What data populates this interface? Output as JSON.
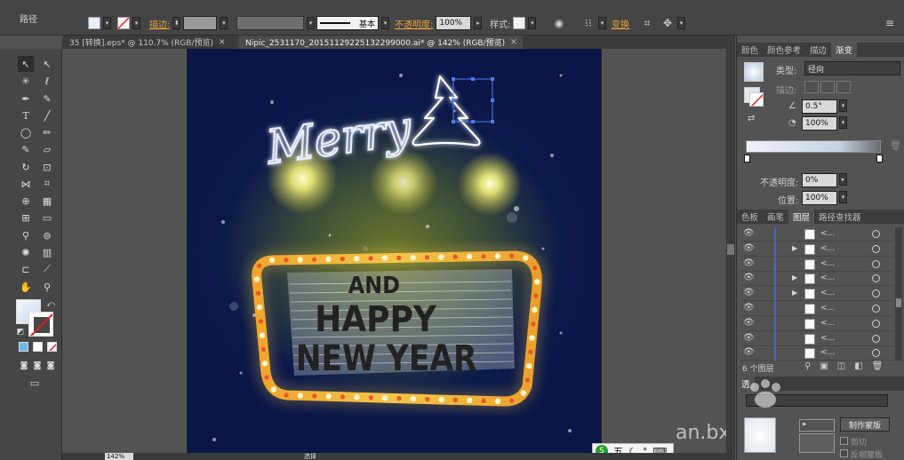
{
  "control_bar": {
    "object_type": "路径",
    "stroke_label": "描边:",
    "stroke_profile": "基本",
    "opacity_label": "不透明度:",
    "opacity_value": "100%",
    "style_label": "样式:",
    "transform_label": "变换"
  },
  "doc_tabs": [
    {
      "label": "35 [转换].eps* @ 110.7% (RGB/预览)",
      "active": false
    },
    {
      "label": "Nipic_2531170_20151129225132299000.ai* @ 142% (RGB/预览)",
      "active": true
    }
  ],
  "artwork": {
    "merry_text": "Merry",
    "line1": "AND",
    "line2": "HAPPY",
    "line3": "NEW YEAR"
  },
  "status_bar": {
    "zoom": "142%",
    "mode": "选择"
  },
  "gradient_panel": {
    "tabs": [
      "颜色",
      "颜色参考",
      "描边",
      "渐变"
    ],
    "type_label": "类型:",
    "type_value": "径向",
    "stroke_label": "描边:",
    "angle_value": "0.5°",
    "aspect_value": "100%",
    "opacity_label": "不透明度:",
    "opacity_value": "0%",
    "location_label": "位置:",
    "location_value": "100%"
  },
  "layers_panel": {
    "tabs": [
      "色板",
      "画笔",
      "图层",
      "路径查找器"
    ],
    "rows": [
      {
        "name": "<...",
        "expand": false
      },
      {
        "name": "<...",
        "expand": true
      },
      {
        "name": "<...",
        "expand": false
      },
      {
        "name": "<...",
        "expand": true
      },
      {
        "name": "<...",
        "expand": true
      },
      {
        "name": "<...",
        "expand": false
      },
      {
        "name": "<...",
        "expand": false
      },
      {
        "name": "<...",
        "expand": false
      },
      {
        "name": "<...",
        "expand": false
      }
    ],
    "count_label": "6 个图层"
  },
  "transparency_panel": {
    "tab": "透",
    "make_mask_button": "制作蒙版",
    "clip_label": "剪切",
    "invert_mask_label": "反相蒙版"
  },
  "watermark": "an.bx",
  "ime_bar": {
    "lang": "五"
  },
  "colors": {
    "accent_orange": "#e9a23b",
    "selection_blue": "#3d6ccf"
  }
}
